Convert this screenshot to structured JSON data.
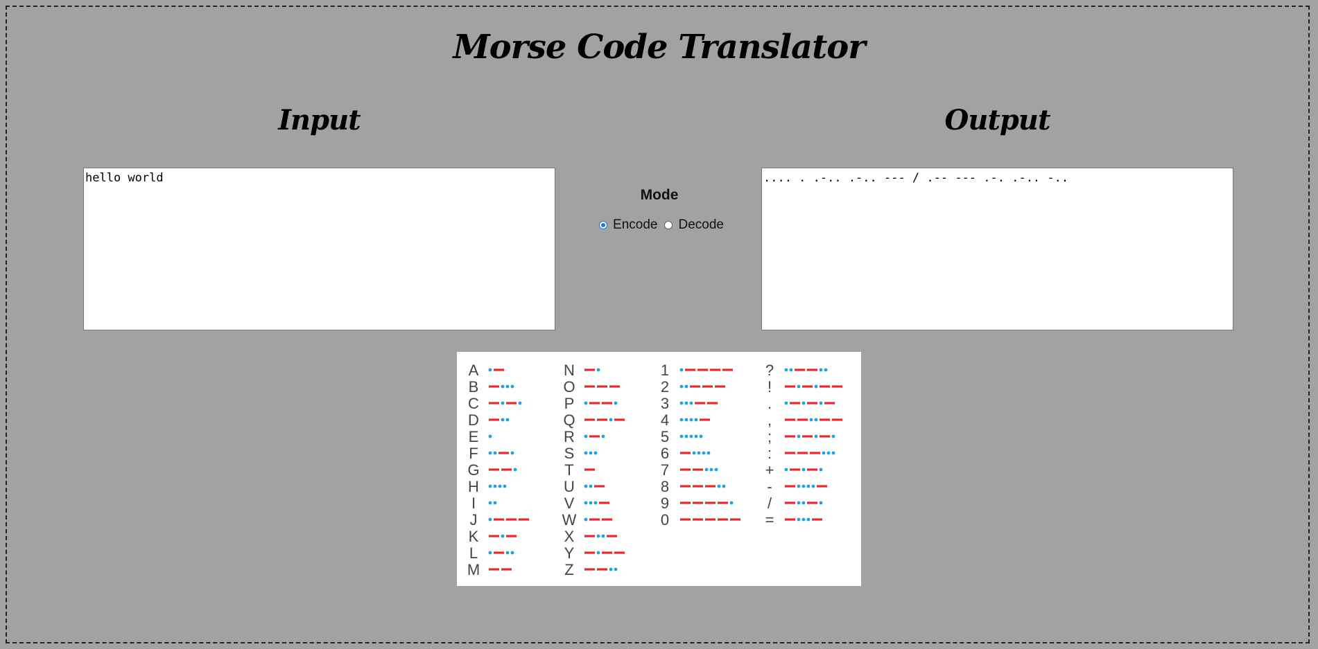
{
  "page": {
    "title": "Morse Code Translator"
  },
  "input": {
    "heading": "Input",
    "value": "hello world"
  },
  "output": {
    "heading": "Output",
    "value": ".... . .-.. .-.. --- / .-- --- .-. .-.. -.."
  },
  "mode": {
    "label": "Mode",
    "options": [
      {
        "label": "Encode",
        "selected": true
      },
      {
        "label": "Decode",
        "selected": false
      }
    ]
  },
  "morse_chart": {
    "colors": {
      "dot": "#1ea2e6",
      "dash": "#e6282b",
      "char": "#444444"
    },
    "columns": [
      [
        [
          "A",
          ".-"
        ],
        [
          "B",
          "-..."
        ],
        [
          "C",
          "-.-."
        ],
        [
          "D",
          "-.."
        ],
        [
          "E",
          "."
        ],
        [
          "F",
          "..-."
        ],
        [
          "G",
          "--."
        ],
        [
          "H",
          "...."
        ],
        [
          "I",
          ".."
        ],
        [
          "J",
          ".---"
        ],
        [
          "K",
          "-.-"
        ],
        [
          "L",
          ".-.."
        ],
        [
          "M",
          "--"
        ]
      ],
      [
        [
          "N",
          "-."
        ],
        [
          "O",
          "---"
        ],
        [
          "P",
          ".--."
        ],
        [
          "Q",
          "--.-"
        ],
        [
          "R",
          ".-."
        ],
        [
          "S",
          "..."
        ],
        [
          "T",
          "-"
        ],
        [
          "U",
          "..-"
        ],
        [
          "V",
          "...-"
        ],
        [
          "W",
          ".--"
        ],
        [
          "X",
          "-..-"
        ],
        [
          "Y",
          "-.--"
        ],
        [
          "Z",
          "--.."
        ]
      ],
      [
        [
          "1",
          ".----"
        ],
        [
          "2",
          "..---"
        ],
        [
          "3",
          "...--"
        ],
        [
          "4",
          "....-"
        ],
        [
          "5",
          "....."
        ],
        [
          "6",
          "-...."
        ],
        [
          "7",
          "--..."
        ],
        [
          "8",
          "---.."
        ],
        [
          "9",
          "----."
        ],
        [
          "0",
          "-----"
        ]
      ],
      [
        [
          "?",
          "..--.."
        ],
        [
          "!",
          "-.-.--"
        ],
        [
          ".",
          ".-.-.-"
        ],
        [
          ",",
          "--..--"
        ],
        [
          ";",
          "-.-.-."
        ],
        [
          ":",
          "---..."
        ],
        [
          "+",
          ".-.-."
        ],
        [
          "-",
          "-....-"
        ],
        [
          "/",
          "-..-."
        ],
        [
          "=",
          "-...-"
        ]
      ]
    ]
  }
}
